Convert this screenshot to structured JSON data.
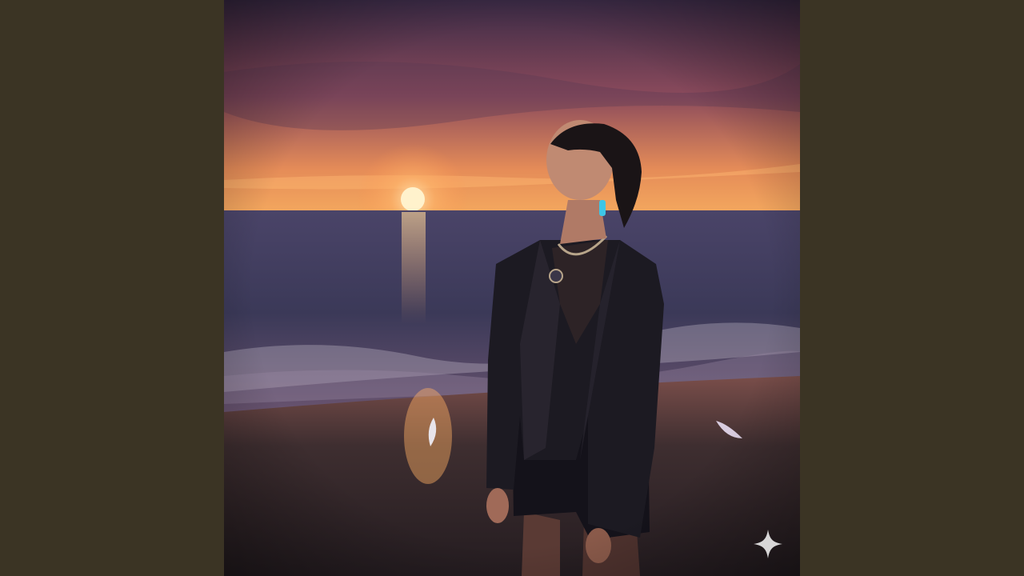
{
  "page": {
    "background_color": "#3b3424",
    "artwork": {
      "kind": "photo",
      "subject": "woman-on-beach-at-sunset",
      "palette": {
        "sky_top": "#3a2a45",
        "sky_mid": "#8a4a5c",
        "horizon_glow": "#f0a25a",
        "sun": "#fff2cc",
        "sea": "#3e3b5a",
        "sand": "#2c2226"
      }
    },
    "overlay_icon": "sparkle-icon"
  }
}
